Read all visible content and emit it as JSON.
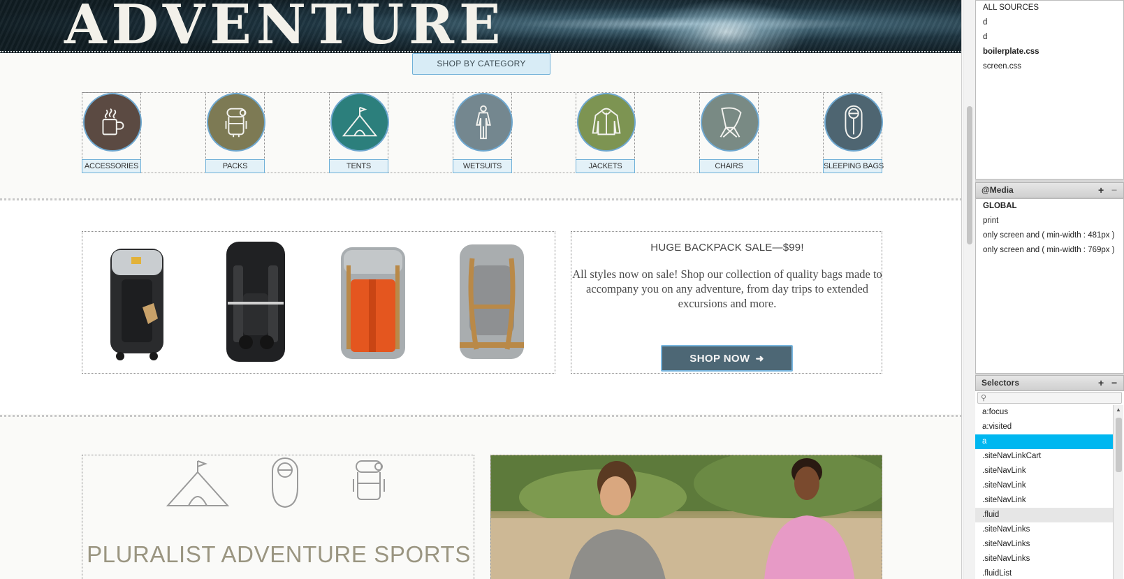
{
  "hero": {
    "title": "ADVENTURE"
  },
  "shop_by_category": "SHOP BY CATEGORY",
  "categories": [
    {
      "label": "ACCESSORIES",
      "icon": "mug-icon",
      "color": "#5b4a42"
    },
    {
      "label": "PACKS",
      "icon": "pack-icon",
      "color": "#7d7a54"
    },
    {
      "label": "TENTS",
      "icon": "tent-icon",
      "color": "#2c7f7c"
    },
    {
      "label": "WETSUITS",
      "icon": "wetsuit-icon",
      "color": "#74878f"
    },
    {
      "label": "JACKETS",
      "icon": "jacket-icon",
      "color": "#7d9452"
    },
    {
      "label": "CHAIRS",
      "icon": "chair-icon",
      "color": "#798a84"
    },
    {
      "label": "SLEEPING BAGS",
      "icon": "sleeping-bag-icon",
      "color": "#4e6571"
    }
  ],
  "sale": {
    "title": "HUGE BACKPACK SALE—$99!",
    "body": "All styles now on sale! Shop our collection of quality bags made to accompany you on any adventure, from day trips to extended excursions and more.",
    "button": "SHOP NOW",
    "button_icon": "arrow-right-icon"
  },
  "about": {
    "title": "PLURALIST ADVENTURE SPORTS"
  },
  "panel": {
    "sources": [
      "ALL SOURCES",
      "d",
      "d",
      "boilerplate.css",
      "screen.css"
    ],
    "media_header": "@Media",
    "media_items": [
      "GLOBAL",
      "print",
      "only screen and ( min-width : 481px )",
      "only screen and ( min-width : 769px )"
    ],
    "selectors_header": "Selectors",
    "selector_items": [
      "a:focus",
      "a:visited",
      "a",
      ".siteNavLinkCart",
      ".siteNavLink",
      ".siteNavLink",
      ".siteNavLink",
      ".fluid",
      ".siteNavLinks",
      ".siteNavLinks",
      ".siteNavLinks",
      ".fluidList"
    ],
    "add_label": "+",
    "remove_label": "−"
  },
  "colors": {
    "accent": "#00b7f0",
    "button": "#4d6775",
    "title_muted": "#9a9581"
  }
}
